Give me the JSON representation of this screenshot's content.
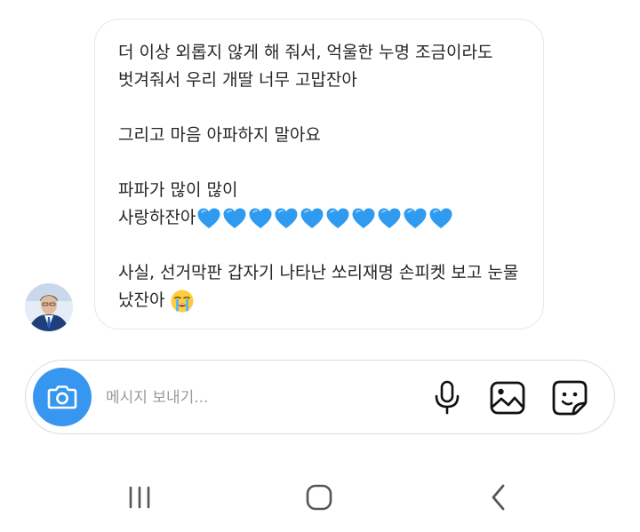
{
  "message": {
    "sender_avatar": "avatar-photo",
    "lines": [
      "더 이상 외롭지 않게 해 줘서, 억울한 누명 조금이라도",
      "벗겨줘서 우리 개딸 너무 고맙잔아",
      "",
      "그리고 마음 아파하지 말아요",
      "",
      "파파가 많이 많이",
      "사랑하잔아",
      "",
      "사실, 선거막판 갑자기 나타난 쏘리재명 손피켓 보고 눈물",
      "났잔아"
    ],
    "hearts_count": 10,
    "heart_color": "#2f9bf0",
    "trailing_emoji": "loudly-crying-face"
  },
  "composer": {
    "placeholder": "메시지 보내기...",
    "value": "",
    "camera_color": "#3797f0"
  },
  "icons": {
    "camera": "camera-icon",
    "mic": "microphone-icon",
    "gallery": "image-icon",
    "sticker": "sticker-icon",
    "nav_recents": "recents-icon",
    "nav_home": "home-icon",
    "nav_back": "back-icon"
  }
}
